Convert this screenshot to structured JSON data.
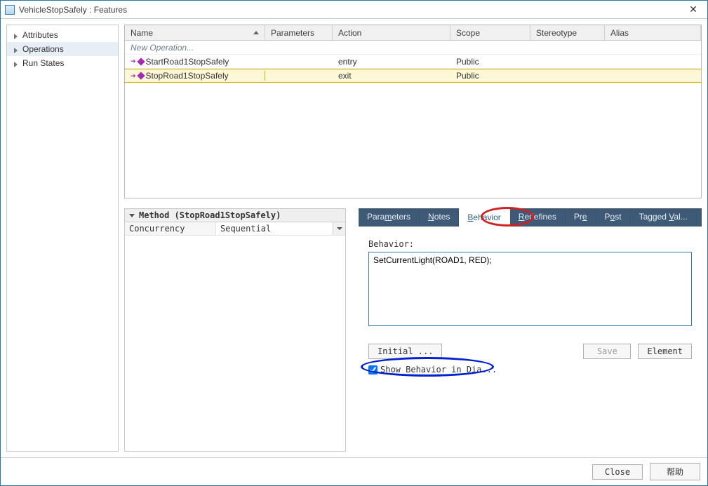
{
  "window": {
    "title": "VehicleStopSafely : Features"
  },
  "sidebar": {
    "items": [
      {
        "label": "Attributes"
      },
      {
        "label": "Operations"
      },
      {
        "label": "Run States"
      }
    ],
    "selected_index": 1
  },
  "table": {
    "headers": {
      "name": "Name",
      "parameters": "Parameters",
      "action": "Action",
      "scope": "Scope",
      "stereotype": "Stereotype",
      "alias": "Alias"
    },
    "placeholder": "New Operation...",
    "rows": [
      {
        "name": "StartRoad1StopSafely",
        "parameters": "",
        "action": "entry",
        "scope": "Public",
        "stereotype": "",
        "alias": ""
      },
      {
        "name": "StopRoad1StopSafely",
        "parameters": "",
        "action": "exit",
        "scope": "Public",
        "stereotype": "",
        "alias": ""
      }
    ],
    "selected_index": 1
  },
  "method": {
    "heading": "Method (StopRoad1StopSafely)",
    "rows": [
      {
        "key": "Concurrency",
        "value": "Sequential"
      }
    ]
  },
  "tabs": {
    "items": [
      {
        "label": "Parameters",
        "ul": "m"
      },
      {
        "label": "Notes",
        "ul": "N"
      },
      {
        "label": "Behavior",
        "ul": "B"
      },
      {
        "label": "Redefines",
        "ul": "R"
      },
      {
        "label": "Pre",
        "ul": "e"
      },
      {
        "label": "Post",
        "ul": "o"
      },
      {
        "label": "Tagged Val...",
        "ul": "V"
      }
    ],
    "active_index": 2
  },
  "behavior": {
    "label": "Behavior:",
    "text": "SetCurrentLight(ROAD1, RED);",
    "initial_btn": "Initial ...",
    "save_btn": "Save",
    "element_btn": "Element",
    "checkbox_label": "Show Behavior in Dia...",
    "checkbox_checked": true
  },
  "bottom": {
    "close": "Close",
    "help": "帮助"
  }
}
